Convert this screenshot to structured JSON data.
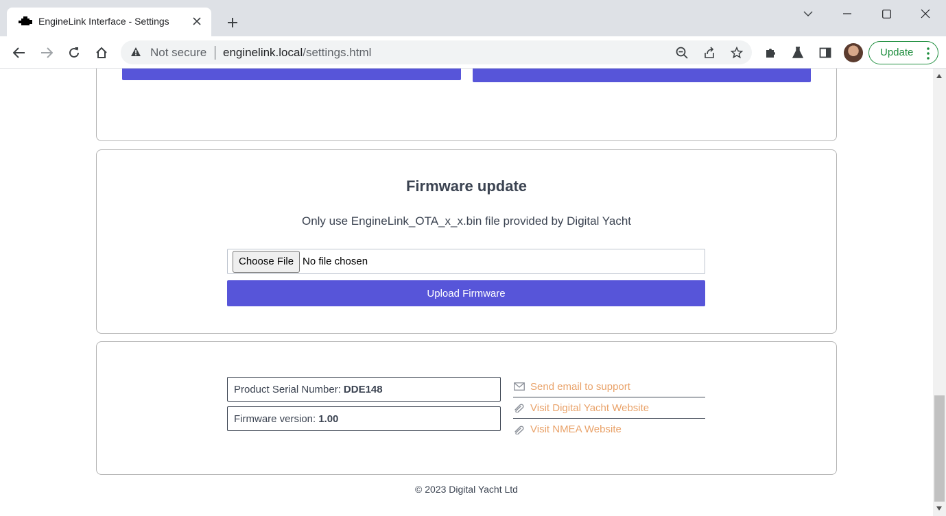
{
  "browser": {
    "tab_title": "EngineLink Interface - Settings",
    "security_label": "Not secure",
    "url_host": "enginelink.local",
    "url_path": "/settings.html",
    "update_label": "Update"
  },
  "firmware": {
    "title": "Firmware update",
    "note": "Only use EngineLink_OTA_x_x.bin file provided by Digital Yacht",
    "choose_file_label": "Choose File",
    "no_file_text": "No file chosen",
    "upload_label": "Upload Firmware"
  },
  "info": {
    "serial_label": "Product Serial Number:",
    "serial_value": "DDE148",
    "firmware_label": "Firmware version:",
    "firmware_value": "1.00"
  },
  "links": [
    {
      "label": "Send email to support",
      "icon": "envelope-icon"
    },
    {
      "label": "Visit Digital Yacht Website",
      "icon": "paperclip-icon"
    },
    {
      "label": "Visit NMEA Website",
      "icon": "paperclip-icon"
    }
  ],
  "footer": {
    "copyright": "© 2023 Digital Yacht Ltd"
  },
  "colors": {
    "accent": "#5755d9",
    "link": "#e9a269",
    "text": "#3b4351",
    "update_green": "#1e8e3e"
  }
}
